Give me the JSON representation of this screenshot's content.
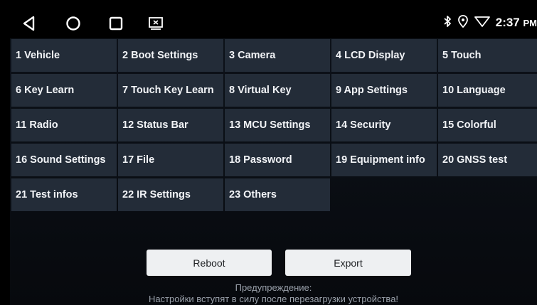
{
  "status_bar": {
    "time": "2:37",
    "ampm": "PM",
    "icons": [
      "back-icon",
      "home-icon",
      "recents-icon",
      "screen-mirror-icon",
      "bluetooth-icon",
      "location-icon",
      "wifi-icon"
    ]
  },
  "tiles": [
    "1 Vehicle",
    "2 Boot Settings",
    "3 Camera",
    "4 LCD Display",
    "5 Touch",
    "6 Key Learn",
    "7 Touch Key Learn",
    "8 Virtual Key",
    "9 App Settings",
    "10 Language",
    "11 Radio",
    "12 Status Bar",
    "13 MCU Settings",
    "14 Security",
    "15 Colorful",
    "16 Sound Settings",
    "17 File",
    "18 Password",
    "19 Equipment info",
    "20 GNSS test",
    "21 Test infos",
    "22 IR Settings",
    "23 Others"
  ],
  "buttons": {
    "reboot": "Reboot",
    "export": "Export"
  },
  "warning": {
    "line1": "Предупреждение:",
    "line2": "Настройки вступят в силу после перезагрузки устройства!"
  },
  "colors": {
    "tile_bg": "#232c38",
    "button_bg": "#eef0f2",
    "status_bar_bg": "#000000"
  }
}
